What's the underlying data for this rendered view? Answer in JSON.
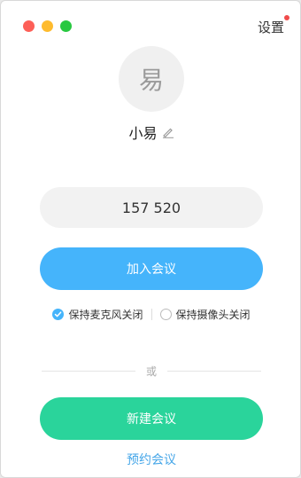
{
  "header": {
    "settings_label": "设置",
    "settings_has_notification": true
  },
  "profile": {
    "avatar_text": "易",
    "name": "小易"
  },
  "meeting": {
    "id_value": "157 520"
  },
  "actions": {
    "join_label": "加入会议",
    "divider_text": "或",
    "new_label": "新建会议",
    "schedule_label": "预约会议"
  },
  "options": {
    "mic_label": "保持麦克风关闭",
    "mic_checked": true,
    "camera_label": "保持摄像头关闭",
    "camera_checked": false
  },
  "colors": {
    "primary": "#45b4fb",
    "new_meeting": "#2ad49b",
    "notification": "#f04b4b"
  }
}
